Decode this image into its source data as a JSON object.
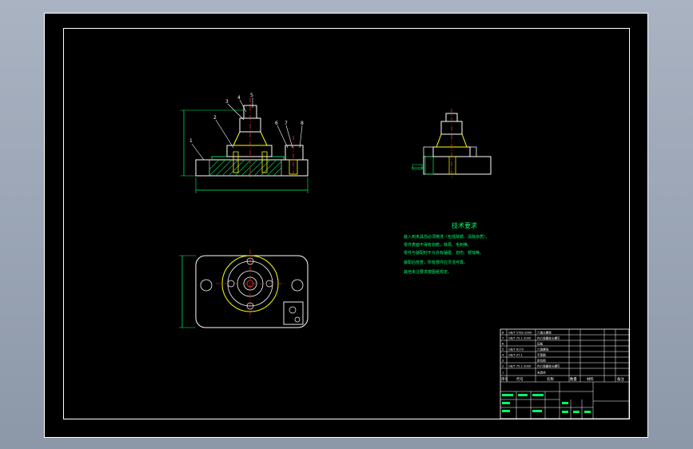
{
  "colors": {
    "background": "#000000",
    "line": "#ffffff",
    "dimension": "#00ff66",
    "highlight": "#ffff00",
    "accent": "#ff3333",
    "hatch": "#00d060",
    "text": "#00ff66"
  },
  "tech_requirements": {
    "title": "技术要求",
    "lines": [
      "装入到夹具前必须擦洗（包括除锈、清除杂质），",
      "零件表面不得有划痕，铁屑、毛刺等。",
      "零件与装配时不允许有磕碰、划伤、锈蚀等。",
      "装配后检查，所有部件应灵活可靠。",
      "其他未注要求按图纸规定。"
    ]
  },
  "callouts": [
    "1",
    "2",
    "3",
    "4",
    "5",
    "6",
    "7",
    "8"
  ],
  "title_block": {
    "col_index": "序号",
    "col_code": "代号",
    "col_name": "名称",
    "col_qty": "数量",
    "col_material": "材料",
    "col_note": "备注",
    "parts": [
      {
        "idx": "8",
        "code": "GB/T 5782-2000",
        "name": "六角头螺栓"
      },
      {
        "idx": "7",
        "code": "GB/T 70.1-2000",
        "name": "内六角圆柱头螺钉"
      },
      {
        "idx": "6",
        "code": "",
        "name": "压板"
      },
      {
        "idx": "5",
        "code": "GB/T 6170",
        "name": "六角螺母"
      },
      {
        "idx": "4",
        "code": "GB/T 97.1",
        "name": "平垫圈"
      },
      {
        "idx": "3",
        "code": "",
        "name": "定位销"
      },
      {
        "idx": "2",
        "code": "GB/T 70.1-2000",
        "name": "内六角圆柱头螺钉"
      },
      {
        "idx": "1",
        "code": "",
        "name": "夹具体"
      }
    ]
  }
}
